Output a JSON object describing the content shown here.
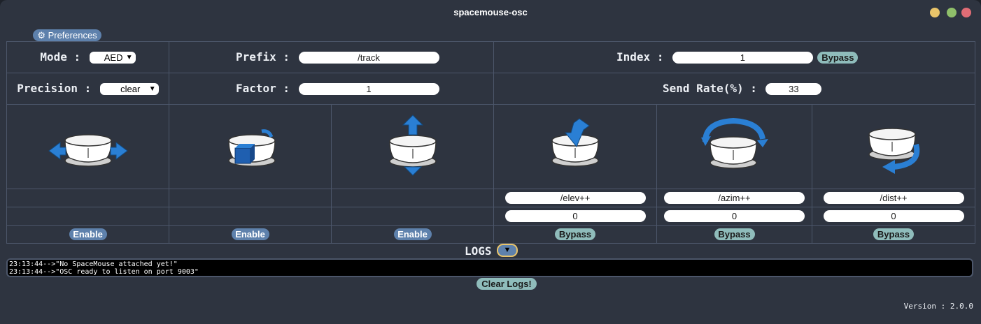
{
  "window": {
    "title": "spacemouse-osc"
  },
  "preferences": {
    "label": "⚙ Preferences"
  },
  "mode": {
    "label": "Mode :",
    "value": "AED"
  },
  "precision": {
    "label": "Precision :",
    "value": "clear"
  },
  "prefix": {
    "label": "Prefix :",
    "value": "/track"
  },
  "factor": {
    "label": "Factor :",
    "value": "1"
  },
  "index": {
    "label": "Index :",
    "value": "1",
    "bypass_label": "Bypass"
  },
  "send_rate": {
    "label": "Send Rate(%) :",
    "value": "33"
  },
  "axes": [
    {
      "icon": "translate-x-icon",
      "action": "Enable"
    },
    {
      "icon": "translate-y-icon",
      "action": "Enable"
    },
    {
      "icon": "translate-z-icon",
      "action": "Enable"
    },
    {
      "icon": "tilt-elevation-icon",
      "address": "/elev++",
      "value": "0",
      "action": "Bypass"
    },
    {
      "icon": "rotate-azimuth-icon",
      "address": "/azim++",
      "value": "0",
      "action": "Bypass"
    },
    {
      "icon": "roll-distance-icon",
      "address": "/dist++",
      "value": "0",
      "action": "Bypass"
    }
  ],
  "logs": {
    "title": "LOGS",
    "toggle": "▼",
    "lines": [
      "23:13:44-->\"No SpaceMouse attached yet!\"",
      "23:13:44-->\"OSC ready to listen on port 9003\""
    ],
    "clear_label": "Clear Logs!"
  },
  "version": "Version : 2.0.0",
  "colors": {
    "background": "#2e3440",
    "accent": "#5e81ac",
    "bypass": "#8fbcbb",
    "icon_blue": "#2a7fd4"
  }
}
